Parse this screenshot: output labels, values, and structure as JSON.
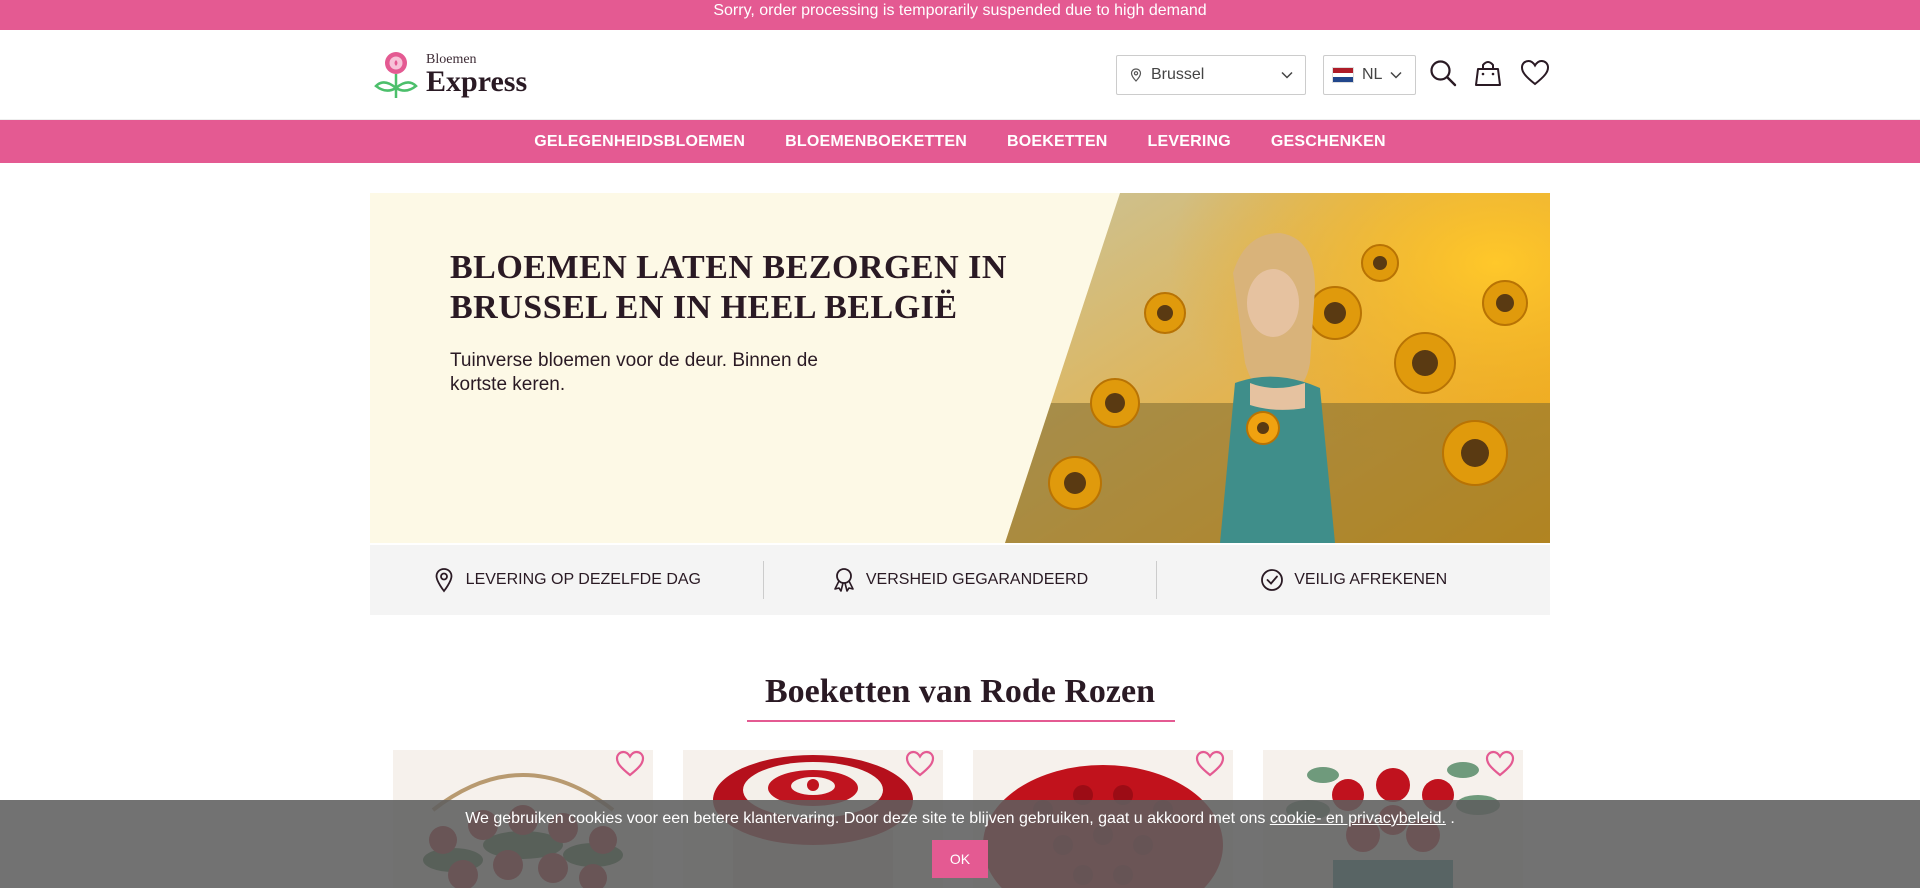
{
  "topbar": {
    "message": "Sorry, order processing is temporarily suspended due to high demand"
  },
  "logo": {
    "line1": "Bloemen",
    "line2": "Express"
  },
  "header": {
    "city": "Brussel",
    "language": "NL",
    "icons": [
      "search-icon",
      "bag-icon",
      "heart-icon"
    ]
  },
  "nav": [
    {
      "label": "GELEGENHEIDSBLOEMEN"
    },
    {
      "label": "BLOEMENBOEKETTEN"
    },
    {
      "label": "BOEKETTEN"
    },
    {
      "label": "LEVERING"
    },
    {
      "label": "GESCHENKEN"
    }
  ],
  "hero": {
    "title": "BLOEMEN LATEN BEZORGEN IN BRUSSEL EN IN HEEL BELGIË",
    "subtitle": "Tuinverse bloemen voor de deur. Binnen de kortste keren."
  },
  "features": [
    {
      "icon": "location-pin-icon",
      "label": "LEVERING OP DEZELFDE DAG"
    },
    {
      "icon": "award-ribbon-icon",
      "label": "VERSHEID GEGARANDEERD"
    },
    {
      "icon": "check-circle-icon",
      "label": "VEILIG AFREKENEN"
    }
  ],
  "section": {
    "title": "Boeketten van Rode Rozen"
  },
  "products": [
    {
      "name": "red-roses-basket"
    },
    {
      "name": "red-white-roses-box"
    },
    {
      "name": "red-roses-round"
    },
    {
      "name": "red-roses-teal-box"
    }
  ],
  "cookie": {
    "text_before": "We gebruiken cookies voor een betere klantervaring. Door deze site te blijven gebruiken, gaat u akkoord met ons ",
    "link": "cookie- en privacybeleid.",
    "text_after": " .",
    "button": "OK"
  },
  "colors": {
    "accent": "#e45a92",
    "hero_bg": "#fdf9e6",
    "text": "#2a1a24"
  }
}
